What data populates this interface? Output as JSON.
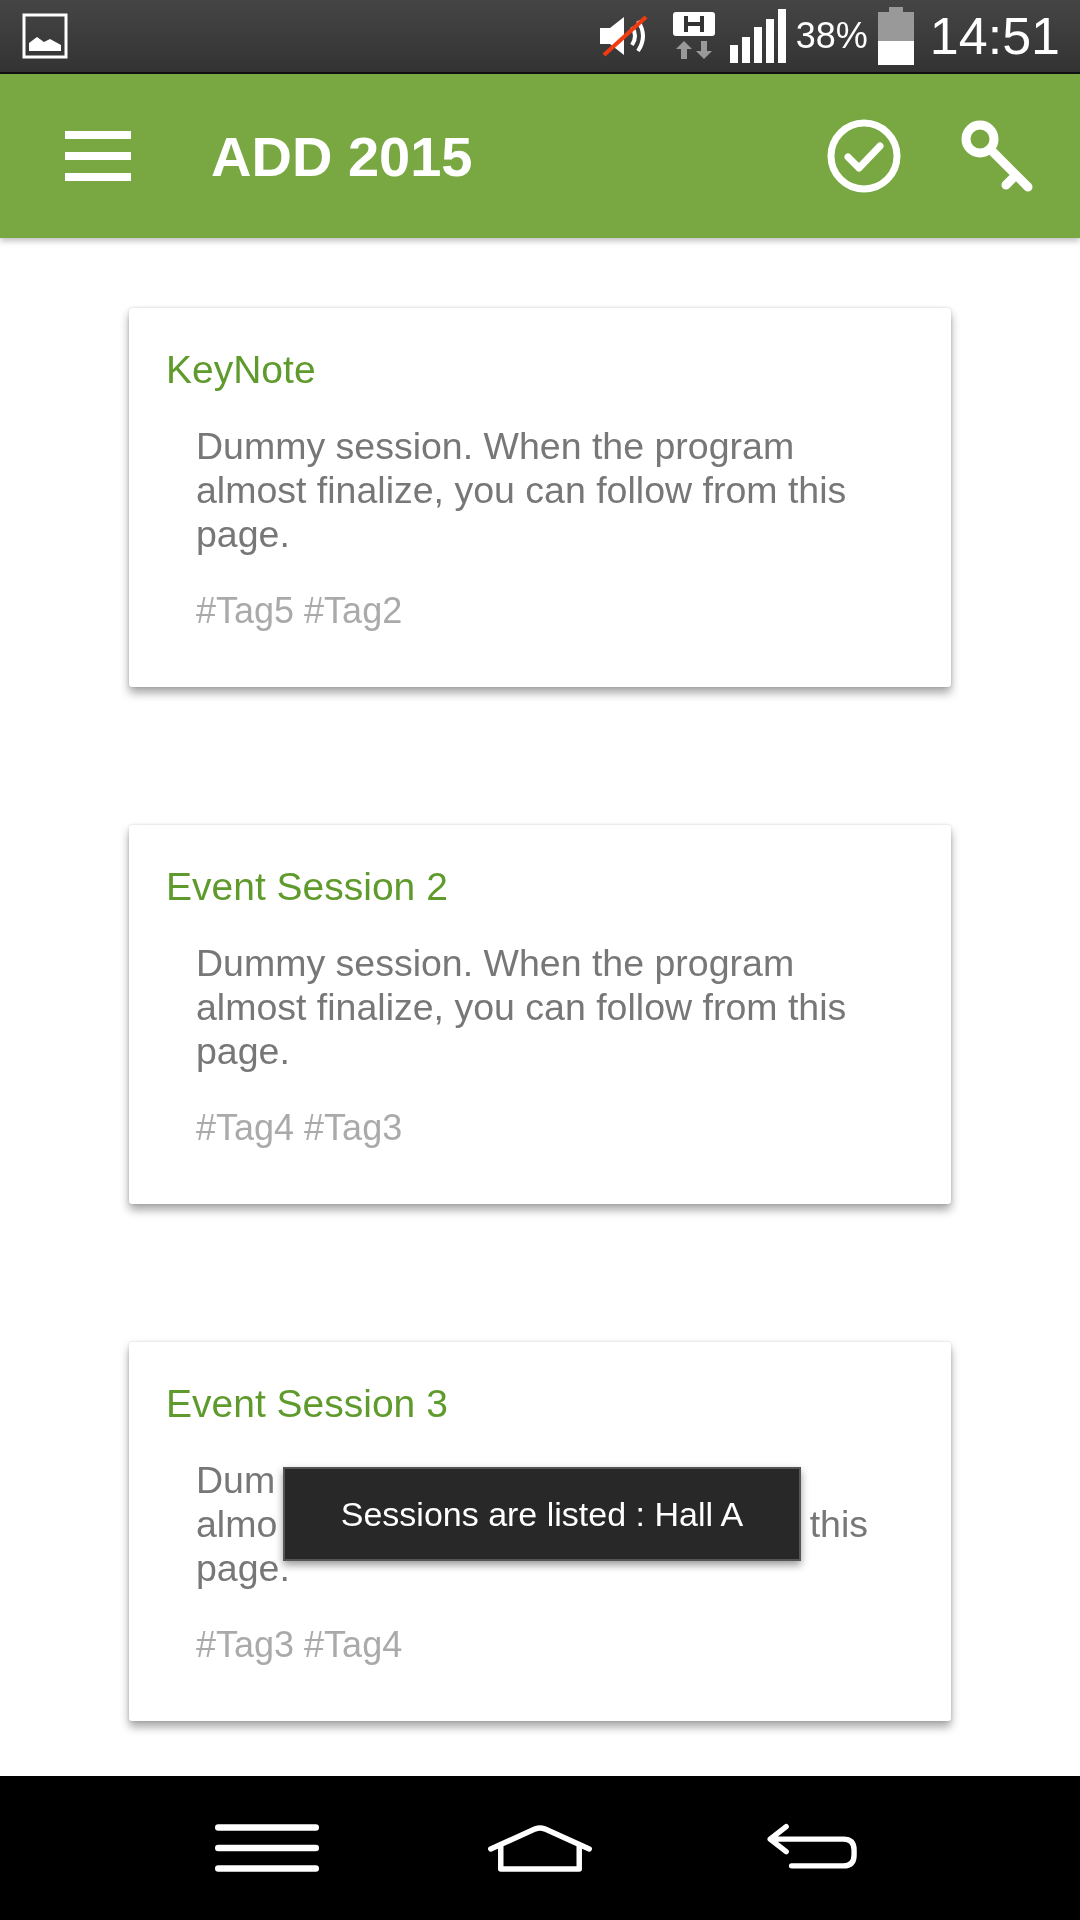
{
  "status_bar": {
    "battery": "38%",
    "time": "14:51"
  },
  "app_bar": {
    "title": "ADD 2015"
  },
  "cards": [
    {
      "title": "KeyNote",
      "description": "Dummy session. When the program almost finalize, you can follow from this page.",
      "tags": "#Tag5 #Tag2"
    },
    {
      "title": "Event Session 2",
      "description": "Dummy session. When the program almost finalize, you can follow from this page.",
      "tags": "#Tag4 #Tag3"
    },
    {
      "title": "Event Session 3",
      "visible_lines": [
        {
          "left": "Dum"
        },
        {
          "left": "almo",
          "right": "this"
        },
        {
          "left": "page."
        }
      ],
      "tags": "#Tag3 #Tag4"
    }
  ],
  "toast": {
    "text": "Sessions are listed : Hall A"
  }
}
